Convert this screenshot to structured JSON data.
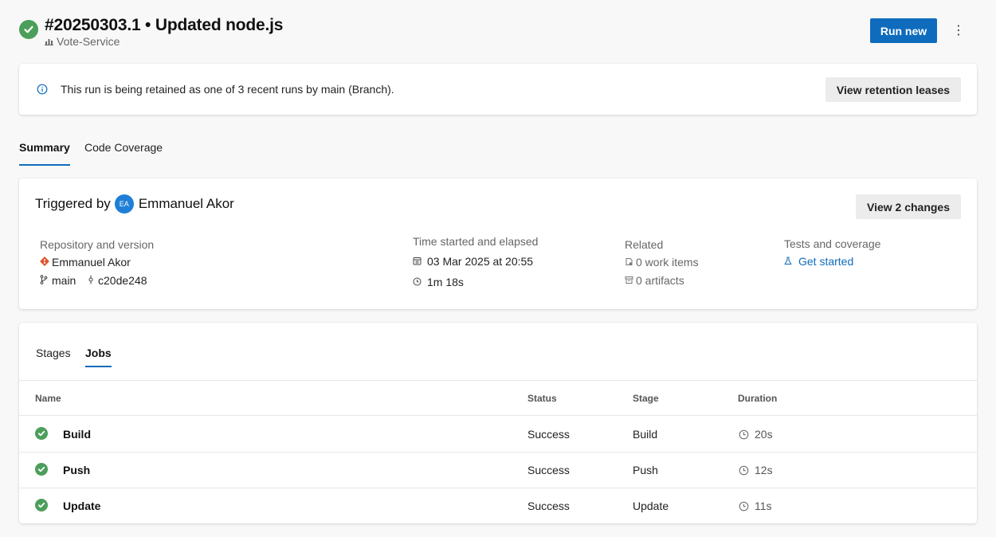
{
  "run": {
    "title": "#20250303.1 • Updated node.js",
    "pipeline": "Vote-Service",
    "status_color": "#4c9f5b"
  },
  "actions": {
    "run_new": "Run new",
    "more": "⋮"
  },
  "banner": {
    "text": "This run is being retained as one of 3 recent runs by main (Branch).",
    "button": "View retention leases"
  },
  "tabs": [
    {
      "label": "Summary",
      "active": true
    },
    {
      "label": "Code Coverage",
      "active": false
    }
  ],
  "summary": {
    "triggered_by_label": "Triggered by",
    "user_initials": "EA",
    "user_name": "Emmanuel Akor",
    "view_changes": "View 2 changes",
    "repo": {
      "label": "Repository and version",
      "name": "Emmanuel Akor",
      "branch": "main",
      "commit": "c20de248"
    },
    "time": {
      "label": "Time started and elapsed",
      "started": "03 Mar 2025 at 20:55",
      "elapsed": "1m 18s"
    },
    "related": {
      "label": "Related",
      "work_items": "0 work items",
      "artifacts": "0 artifacts"
    },
    "tests": {
      "label": "Tests and coverage",
      "link": "Get started"
    }
  },
  "jobs": {
    "tabs": [
      {
        "label": "Stages",
        "active": false
      },
      {
        "label": "Jobs",
        "active": true
      }
    ],
    "columns": {
      "name": "Name",
      "status": "Status",
      "stage": "Stage",
      "duration": "Duration"
    },
    "rows": [
      {
        "name": "Build",
        "status": "Success",
        "stage": "Build",
        "duration": "20s"
      },
      {
        "name": "Push",
        "status": "Success",
        "stage": "Push",
        "duration": "12s"
      },
      {
        "name": "Update",
        "status": "Success",
        "stage": "Update",
        "duration": "11s"
      }
    ]
  },
  "colors": {
    "accent": "#0f6cbd",
    "success": "#4c9f5b",
    "git": "#e0532b"
  }
}
